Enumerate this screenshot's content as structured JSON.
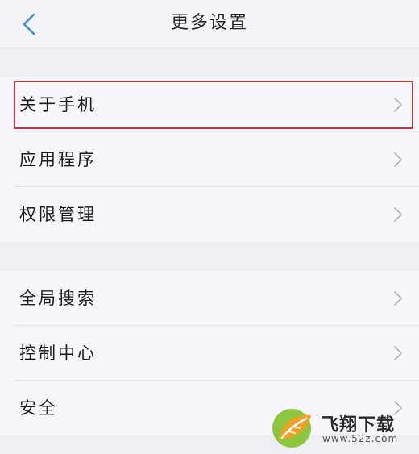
{
  "header": {
    "title": "更多设置",
    "back_icon": "chevron-left-icon",
    "accent": "#3a8ef0"
  },
  "groups": [
    {
      "items": [
        {
          "label": "关于手机",
          "highlighted": true
        },
        {
          "label": "应用程序"
        },
        {
          "label": "权限管理"
        }
      ]
    },
    {
      "items": [
        {
          "label": "全局搜索"
        },
        {
          "label": "控制中心"
        },
        {
          "label": "安全"
        }
      ]
    }
  ],
  "highlight_color": "#c8323c",
  "watermark": {
    "brand": "飞翔下载",
    "url": "www.52z.com"
  }
}
